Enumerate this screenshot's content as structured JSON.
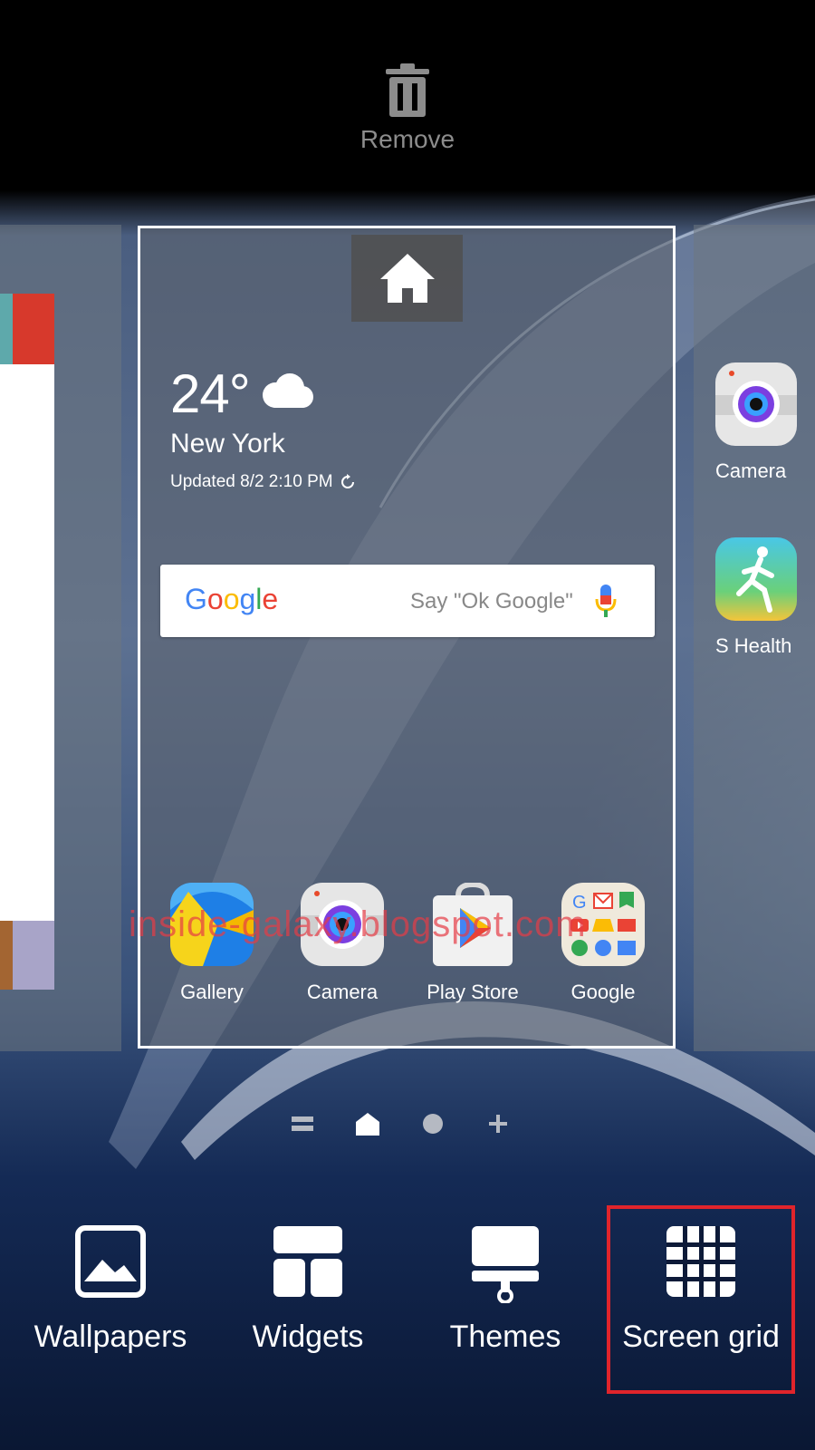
{
  "remove": {
    "label": "Remove"
  },
  "weather": {
    "temperature": "24°",
    "city": "New York",
    "updated": "Updated 8/2 2:10 PM"
  },
  "search": {
    "logo": "Google",
    "hint": "Say \"Ok Google\""
  },
  "dock_apps": [
    {
      "label": "Gallery"
    },
    {
      "label": "Camera"
    },
    {
      "label": "Play Store"
    },
    {
      "label": "Google"
    }
  ],
  "right_page_apps": [
    {
      "label": "Camera"
    },
    {
      "label": "S Health"
    }
  ],
  "watermark": "inside-galaxy.blogspot.com",
  "bottom_options": {
    "wallpapers": "Wallpapers",
    "widgets": "Widgets",
    "themes": "Themes",
    "screen_grid": "Screen grid"
  },
  "colors": {
    "highlight": "#e0242b",
    "google_blue": "#4285F4",
    "google_red": "#EA4335",
    "google_yellow": "#FBBC05",
    "google_green": "#34A853"
  }
}
